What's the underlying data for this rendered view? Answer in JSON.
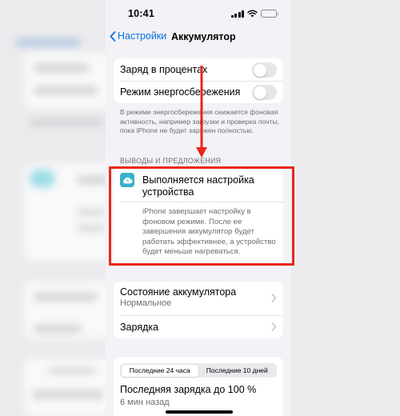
{
  "status_bar": {
    "time": "10:41",
    "battery_level_pct": 90
  },
  "nav": {
    "back_label": "Настройки",
    "title": "Аккумулятор"
  },
  "toggles": [
    {
      "label": "Заряд в процентах",
      "on": false
    },
    {
      "label": "Режим энергосбережения",
      "on": false
    }
  ],
  "power_save_note": "В режиме энергосбережения снижается фоновая активность, например загрузки и проверка почты, пока iPhone не будет заряжен полностью.",
  "suggestions": {
    "header": "ВЫВОДЫ И ПРЕДЛОЖЕНИЯ",
    "title": "Выполняется настройка устройства",
    "body": "iPhone завершает настройку в фоновом режиме. После ее завершения аккумулятор будет работать эффективнее, а устрой­ство будет меньше нагреваться.",
    "icon": "cloud-icon",
    "icon_color": "#36b3c9"
  },
  "battery_group": {
    "health_label": "Состояние аккумулятора",
    "health_value": "Нормальное",
    "charging_label": "Зарядка"
  },
  "usage": {
    "tabs": [
      "Последние 24 часа",
      "Последние 10 дней"
    ],
    "active_tab": 0,
    "last_charge_label": "Последняя зарядка до 100 %",
    "last_charge_time": "6 мин назад"
  },
  "colors": {
    "accent": "#0a72d9",
    "annotation": "#e8271b",
    "background": "#f2f2f7"
  }
}
